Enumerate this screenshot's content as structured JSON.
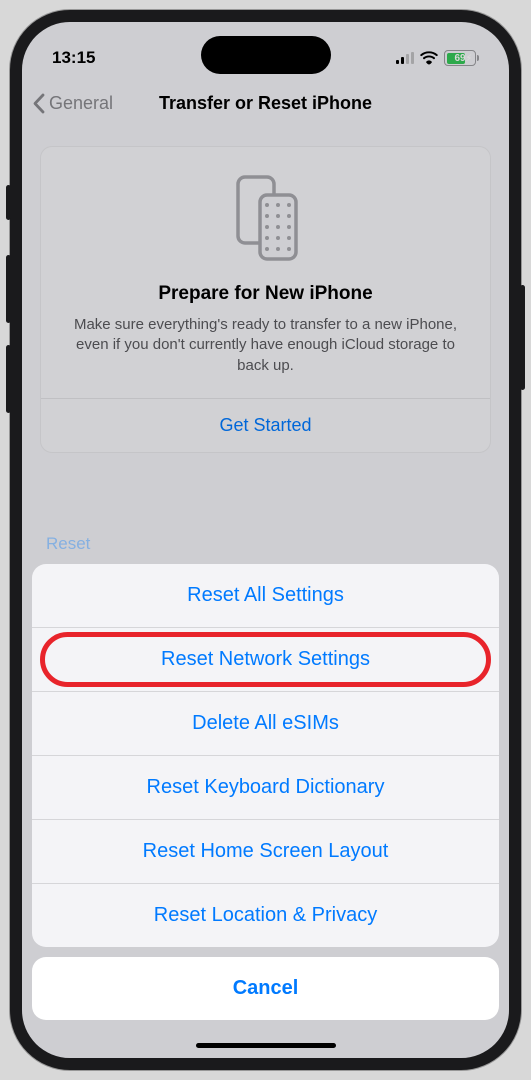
{
  "status_bar": {
    "time": "13:15",
    "battery_percent": "69",
    "battery_bolt": "⚡︎"
  },
  "nav": {
    "back_label": "General",
    "title": "Transfer or Reset iPhone"
  },
  "prepare": {
    "title": "Prepare for New iPhone",
    "description": "Make sure everything's ready to transfer to a new iPhone, even if you don't currently have enough iCloud storage to back up.",
    "get_started": "Get Started"
  },
  "background_leak": "Reset",
  "sheet": {
    "items": [
      {
        "label": "Reset All Settings",
        "highlighted": false
      },
      {
        "label": "Reset Network Settings",
        "highlighted": true
      },
      {
        "label": "Delete All eSIMs",
        "highlighted": false
      },
      {
        "label": "Reset Keyboard Dictionary",
        "highlighted": false
      },
      {
        "label": "Reset Home Screen Layout",
        "highlighted": false
      },
      {
        "label": "Reset Location & Privacy",
        "highlighted": false
      }
    ],
    "cancel": "Cancel"
  }
}
